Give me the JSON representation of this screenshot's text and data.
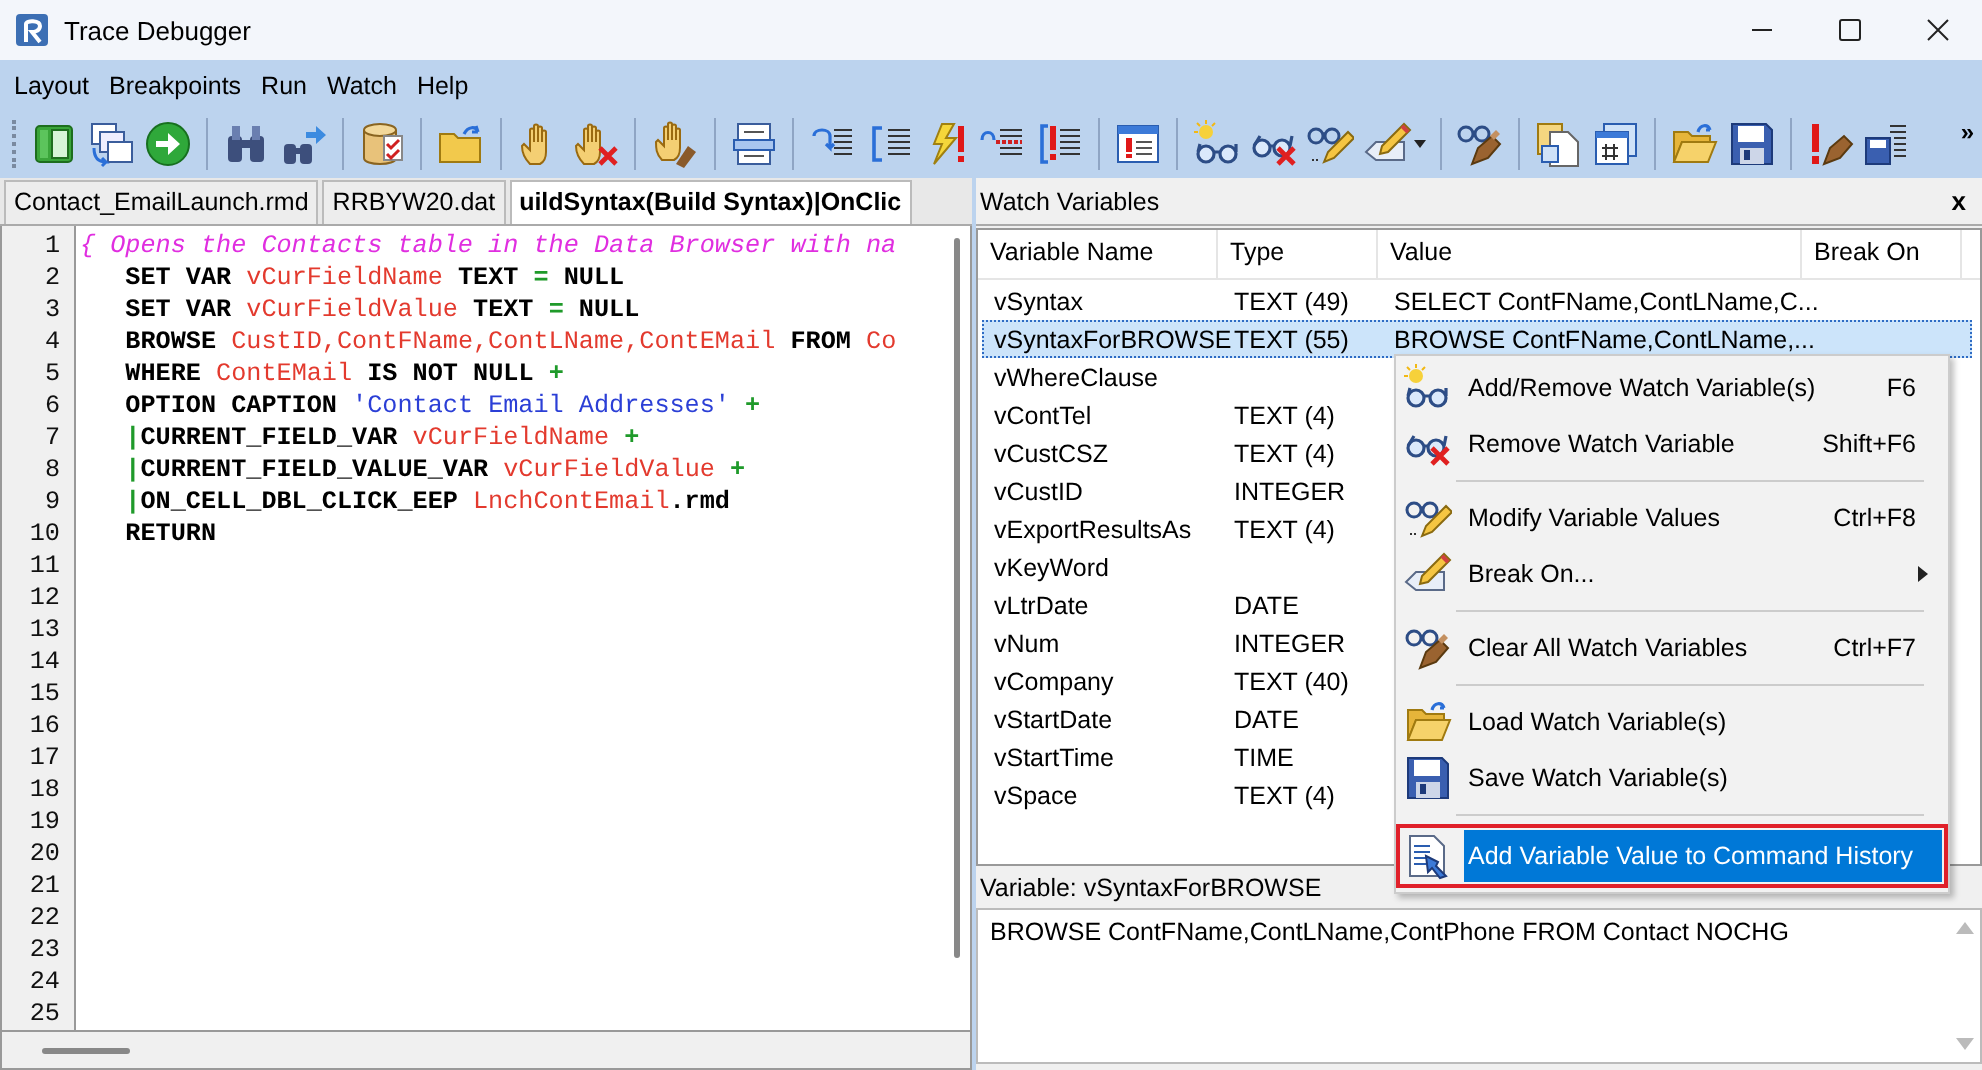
{
  "window": {
    "title": "Trace Debugger"
  },
  "menu_bar": [
    {
      "label": "Layout"
    },
    {
      "label": "Breakpoints"
    },
    {
      "label": "Run"
    },
    {
      "label": "Watch"
    },
    {
      "label": "Help"
    }
  ],
  "toolbar": {
    "overflow": "»"
  },
  "editor_tabs": [
    {
      "label": "Contact_EmailLaunch.rmd",
      "selected": false
    },
    {
      "label": "RRBYW20.dat",
      "selected": false
    },
    {
      "label": "uildSyntax(Build Syntax)|OnClic",
      "selected": true
    }
  ],
  "code_lines": [
    {
      "number": "1",
      "segments": [
        {
          "kind": "comment",
          "text": "{ Opens the Contacts table in the Data Browser with na"
        }
      ]
    },
    {
      "number": "2",
      "segments": [
        {
          "kind": "keyword",
          "text": "   SET VAR "
        },
        {
          "kind": "variable",
          "text": "vCurFieldName"
        },
        {
          "kind": "keyword",
          "text": " TEXT "
        },
        {
          "kind": "operator",
          "text": "="
        },
        {
          "kind": "keyword",
          "text": " NULL"
        }
      ]
    },
    {
      "number": "3",
      "segments": [
        {
          "kind": "keyword",
          "text": "   SET VAR "
        },
        {
          "kind": "variable",
          "text": "vCurFieldValue"
        },
        {
          "kind": "keyword",
          "text": " TEXT "
        },
        {
          "kind": "operator",
          "text": "="
        },
        {
          "kind": "keyword",
          "text": " NULL"
        }
      ]
    },
    {
      "number": "4",
      "segments": [
        {
          "kind": "keyword",
          "text": "   BROWSE "
        },
        {
          "kind": "variable",
          "text": "CustID,ContFName,ContLName,ContEMail"
        },
        {
          "kind": "keyword",
          "text": " FROM "
        },
        {
          "kind": "variable",
          "text": "Co"
        }
      ]
    },
    {
      "number": "5",
      "segments": [
        {
          "kind": "keyword",
          "text": "   WHERE "
        },
        {
          "kind": "variable",
          "text": "ContEMail"
        },
        {
          "kind": "keyword",
          "text": " IS NOT NULL "
        },
        {
          "kind": "operator",
          "text": "+"
        }
      ]
    },
    {
      "number": "6",
      "segments": [
        {
          "kind": "keyword",
          "text": "   OPTION CAPTION "
        },
        {
          "kind": "string",
          "text": "'Contact Email Addresses'"
        },
        {
          "kind": "operator",
          "text": " +"
        }
      ]
    },
    {
      "number": "7",
      "segments": [
        {
          "kind": "operator",
          "text": "   |"
        },
        {
          "kind": "keyword",
          "text": "CURRENT_FIELD_VAR "
        },
        {
          "kind": "variable",
          "text": "vCurFieldName"
        },
        {
          "kind": "operator",
          "text": " +"
        }
      ]
    },
    {
      "number": "8",
      "segments": [
        {
          "kind": "operator",
          "text": "   |"
        },
        {
          "kind": "keyword",
          "text": "CURRENT_FIELD_VALUE_VAR "
        },
        {
          "kind": "variable",
          "text": "vCurFieldValue"
        },
        {
          "kind": "operator",
          "text": " +"
        }
      ]
    },
    {
      "number": "9",
      "segments": [
        {
          "kind": "operator",
          "text": "   |"
        },
        {
          "kind": "keyword",
          "text": "ON_CELL_DBL_CLICK_EEP "
        },
        {
          "kind": "variable",
          "text": "LnchContEmail"
        },
        {
          "kind": "keyword",
          "text": ".rmd"
        }
      ]
    },
    {
      "number": "10",
      "segments": [
        {
          "kind": "keyword",
          "text": "   RETURN"
        }
      ]
    },
    {
      "number": "11"
    },
    {
      "number": "12"
    },
    {
      "number": "13"
    },
    {
      "number": "14"
    },
    {
      "number": "15"
    },
    {
      "number": "16"
    },
    {
      "number": "17"
    },
    {
      "number": "18"
    },
    {
      "number": "19"
    },
    {
      "number": "20"
    },
    {
      "number": "21"
    },
    {
      "number": "22"
    },
    {
      "number": "23"
    },
    {
      "number": "24"
    },
    {
      "number": "25"
    }
  ],
  "watch": {
    "title": "Watch Variables",
    "close": "x",
    "columns": [
      "Variable Name",
      "Type",
      "Value",
      "Break On"
    ],
    "rows": [
      {
        "name": "vSyntax",
        "type": "TEXT (49)",
        "value": "SELECT ContFName,ContLName,C...",
        "selected": false
      },
      {
        "name": "vSyntaxForBROWSE",
        "type": "TEXT (55)",
        "value": "BROWSE ContFName,ContLName,...",
        "selected": true
      },
      {
        "name": "vWhereClause",
        "selected": false
      },
      {
        "name": "vContTel",
        "type": "TEXT (4)",
        "selected": false
      },
      {
        "name": "vCustCSZ",
        "type": "TEXT (4)",
        "selected": false
      },
      {
        "name": "vCustID",
        "type": "INTEGER",
        "selected": false
      },
      {
        "name": "vExportResultsAs",
        "type": "TEXT (4)",
        "selected": false
      },
      {
        "name": "vKeyWord",
        "selected": false
      },
      {
        "name": "vLtrDate",
        "type": "DATE",
        "selected": false
      },
      {
        "name": "vNum",
        "type": "INTEGER",
        "selected": false
      },
      {
        "name": "vCompany",
        "type": "TEXT (40)",
        "selected": false
      },
      {
        "name": "vStartDate",
        "type": "DATE",
        "selected": false
      },
      {
        "name": "vStartTime",
        "type": "TIME",
        "selected": false
      },
      {
        "name": "vSpace",
        "type": "TEXT (4)",
        "selected": false
      }
    ],
    "detail_label": "Variable: vSyntaxForBROWSE",
    "detail_value": "BROWSE ContFName,ContLName,ContPhone FROM Contact NOCHG"
  },
  "context_menu": [
    {
      "kind": "item",
      "label": "Add/Remove Watch Variable(s)",
      "shortcut": "F6",
      "submenu": false,
      "selected": false,
      "highlighted": false
    },
    {
      "kind": "item",
      "label": "Remove Watch Variable",
      "shortcut": "Shift+F6",
      "submenu": false,
      "selected": false,
      "highlighted": false
    },
    {
      "kind": "separator"
    },
    {
      "kind": "item",
      "label": "Modify Variable Values",
      "shortcut": "Ctrl+F8",
      "submenu": false,
      "selected": false,
      "highlighted": false
    },
    {
      "kind": "item",
      "label": "Break On...",
      "submenu": true,
      "selected": false,
      "highlighted": false
    },
    {
      "kind": "separator"
    },
    {
      "kind": "item",
      "label": "Clear All Watch Variables",
      "shortcut": "Ctrl+F7",
      "submenu": false,
      "selected": false,
      "highlighted": false
    },
    {
      "kind": "separator"
    },
    {
      "kind": "item",
      "label": "Load Watch Variable(s)",
      "submenu": false,
      "selected": false,
      "highlighted": false
    },
    {
      "kind": "item",
      "label": "Save Watch Variable(s)",
      "submenu": false,
      "selected": false,
      "highlighted": false
    },
    {
      "kind": "separator"
    },
    {
      "kind": "item",
      "label": "Add Variable Value to Command History",
      "submenu": false,
      "selected": true,
      "highlighted": true
    }
  ]
}
